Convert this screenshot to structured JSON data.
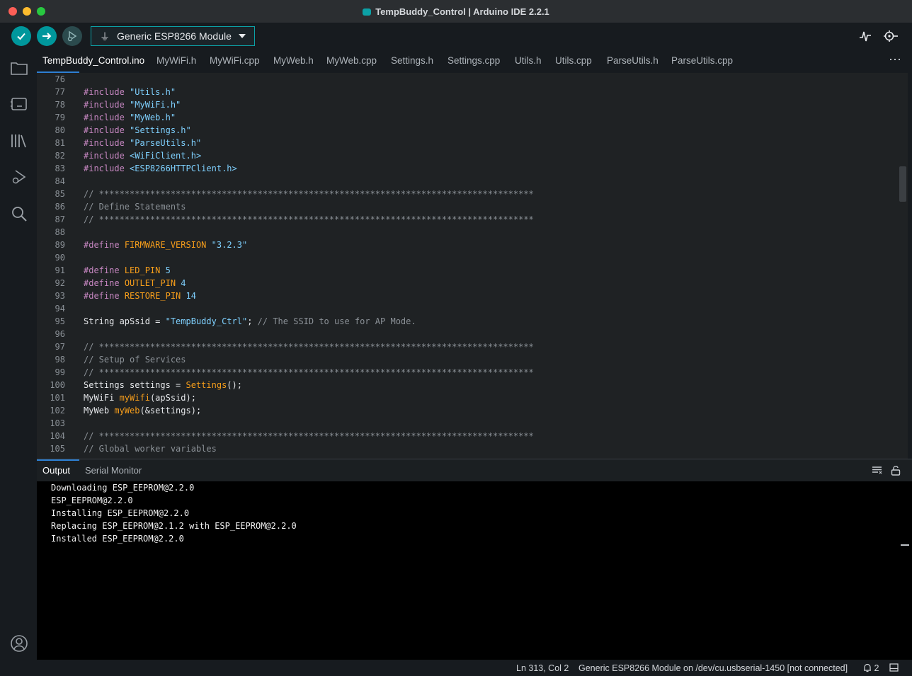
{
  "window": {
    "title": "TempBuddy_Control | Arduino IDE 2.2.1"
  },
  "toolbar": {
    "board": "Generic ESP8266 Module",
    "icons": [
      "verify-icon",
      "upload-icon",
      "debug-icon",
      "usb-icon",
      "serial-plotter-icon",
      "serial-monitor-icon"
    ]
  },
  "sidebar": {
    "icons": [
      "folder-icon",
      "board-manager-icon",
      "library-icon",
      "debug-icon",
      "search-icon",
      "account-icon"
    ]
  },
  "tabs": [
    {
      "label": "TempBuddy_Control.ino",
      "active": true
    },
    {
      "label": "MyWiFi.h"
    },
    {
      "label": "MyWiFi.cpp"
    },
    {
      "label": "MyWeb.h"
    },
    {
      "label": "MyWeb.cpp"
    },
    {
      "label": "Settings.h"
    },
    {
      "label": "Settings.cpp"
    },
    {
      "label": "Utils.h"
    },
    {
      "label": "Utils.cpp"
    },
    {
      "label": "ParseUtils.h"
    },
    {
      "label": "ParseUtils.cpp"
    }
  ],
  "editor": {
    "lines": [
      {
        "n": "76",
        "t": ""
      },
      {
        "n": "77",
        "t": "#include \"Utils.h\""
      },
      {
        "n": "78",
        "t": "#include \"MyWiFi.h\""
      },
      {
        "n": "79",
        "t": "#include \"MyWeb.h\""
      },
      {
        "n": "80",
        "t": "#include \"Settings.h\""
      },
      {
        "n": "81",
        "t": "#include \"ParseUtils.h\""
      },
      {
        "n": "82",
        "t": "#include <WiFiClient.h>"
      },
      {
        "n": "83",
        "t": "#include <ESP8266HTTPClient.h>"
      },
      {
        "n": "84",
        "t": ""
      },
      {
        "n": "85",
        "t": "// *************************************************************************************"
      },
      {
        "n": "86",
        "t": "// Define Statements"
      },
      {
        "n": "87",
        "t": "// *************************************************************************************"
      },
      {
        "n": "88",
        "t": ""
      },
      {
        "n": "89",
        "t": "#define FIRMWARE_VERSION \"3.2.3\""
      },
      {
        "n": "90",
        "t": ""
      },
      {
        "n": "91",
        "t": "#define LED_PIN 5"
      },
      {
        "n": "92",
        "t": "#define OUTLET_PIN 4"
      },
      {
        "n": "93",
        "t": "#define RESTORE_PIN 14"
      },
      {
        "n": "94",
        "t": ""
      },
      {
        "n": "95",
        "t": "String apSsid = \"TempBuddy_Ctrl\"; // The SSID to use for AP Mode."
      },
      {
        "n": "96",
        "t": ""
      },
      {
        "n": "97",
        "t": "// *************************************************************************************"
      },
      {
        "n": "98",
        "t": "// Setup of Services"
      },
      {
        "n": "99",
        "t": "// *************************************************************************************"
      },
      {
        "n": "100",
        "t": "Settings settings = Settings();"
      },
      {
        "n": "101",
        "t": "MyWiFi myWifi(apSsid);"
      },
      {
        "n": "102",
        "t": "MyWeb myWeb(&settings);"
      },
      {
        "n": "103",
        "t": ""
      },
      {
        "n": "104",
        "t": "// *************************************************************************************"
      },
      {
        "n": "105",
        "t": "// Global worker variables"
      }
    ]
  },
  "output_panel": {
    "tabs": [
      "Output",
      "Serial Monitor"
    ],
    "lines": [
      "Downloading ESP_EEPROM@2.2.0",
      "ESP_EEPROM@2.2.0",
      "Installing ESP_EEPROM@2.2.0",
      "Replacing ESP_EEPROM@2.1.2 with ESP_EEPROM@2.2.0",
      "Installed ESP_EEPROM@2.2.0"
    ]
  },
  "status": {
    "cursor": "Ln 313, Col 2",
    "board_port": "Generic ESP8266 Module on /dev/cu.usbserial-1450 [not connected]",
    "notifications": "2"
  }
}
